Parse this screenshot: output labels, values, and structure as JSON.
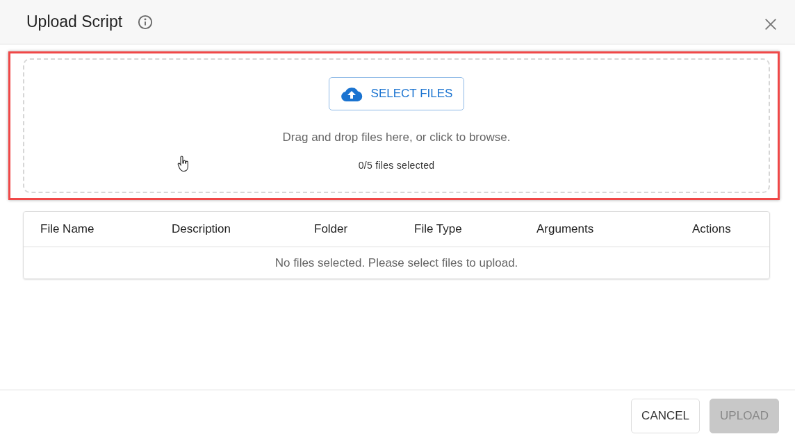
{
  "dialog": {
    "title": "Upload Script"
  },
  "dropzone": {
    "highlighted": true,
    "button": "SELECT FILES",
    "hint": "Drag and drop files here, or click to browse.",
    "count": "0/5 files selected"
  },
  "table": {
    "columns": [
      "File Name",
      "Description",
      "Folder",
      "File Type",
      "Arguments",
      "Actions"
    ],
    "empty_message": "No files selected. Please select files to upload."
  },
  "buttons": [
    {
      "label": "CANCEL",
      "disabled": false
    },
    {
      "label": "UPLOAD",
      "disabled": true
    }
  ]
}
